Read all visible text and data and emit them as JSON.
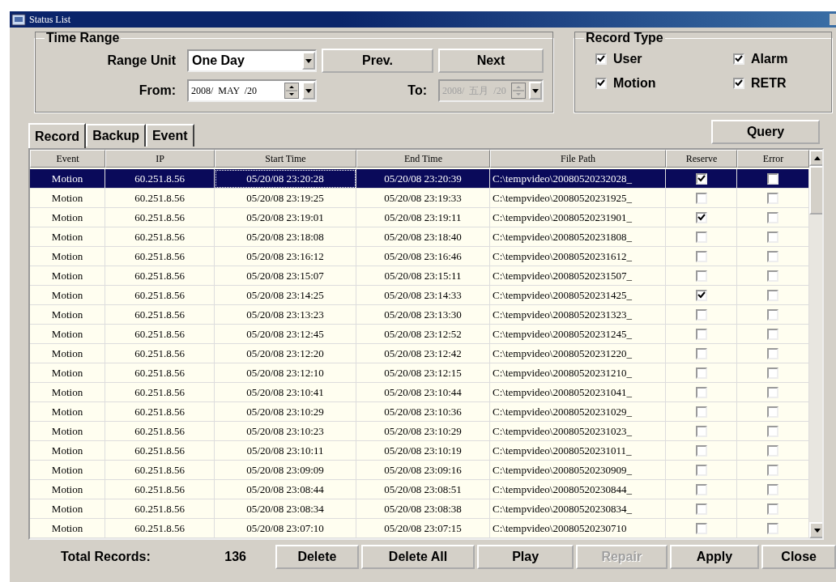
{
  "window": {
    "title": "Status List"
  },
  "time_range": {
    "title": "Time Range",
    "range_unit_label": "Range Unit",
    "range_unit": "One Day",
    "prev": "Prev.",
    "next": "Next",
    "from_label": "From:",
    "from": {
      "value": "2008/  MAY  /20",
      "disabled": false
    },
    "to_label": "To:",
    "to": {
      "value": "2008/  五月  /20",
      "disabled": true
    }
  },
  "record_type": {
    "title": "Record Type",
    "options": [
      {
        "label": "User",
        "checked": true
      },
      {
        "label": "Alarm",
        "checked": true
      },
      {
        "label": "Motion",
        "checked": true
      },
      {
        "label": "RETR",
        "checked": true
      }
    ]
  },
  "tabs": [
    {
      "label": "Record",
      "selected": true
    },
    {
      "label": "Backup",
      "selected": false
    },
    {
      "label": "Event",
      "selected": false
    }
  ],
  "query_button": "Query",
  "table": {
    "columns": [
      "Event",
      "IP",
      "Start Time",
      "End Time",
      "File Path",
      "Reserve",
      "Error"
    ],
    "rows": [
      {
        "event": "Motion",
        "ip": "60.251.8.56",
        "start": "05/20/08 23:20:28",
        "end": "05/20/08 23:20:39",
        "path": "C:\\tempvideo\\20080520232028_",
        "reserve": true,
        "error": false,
        "selected": true
      },
      {
        "event": "Motion",
        "ip": "60.251.8.56",
        "start": "05/20/08 23:19:25",
        "end": "05/20/08 23:19:33",
        "path": "C:\\tempvideo\\20080520231925_",
        "reserve": false,
        "error": false,
        "selected": false
      },
      {
        "event": "Motion",
        "ip": "60.251.8.56",
        "start": "05/20/08 23:19:01",
        "end": "05/20/08 23:19:11",
        "path": "C:\\tempvideo\\20080520231901_",
        "reserve": true,
        "error": false,
        "selected": false
      },
      {
        "event": "Motion",
        "ip": "60.251.8.56",
        "start": "05/20/08 23:18:08",
        "end": "05/20/08 23:18:40",
        "path": "C:\\tempvideo\\20080520231808_",
        "reserve": false,
        "error": false,
        "selected": false
      },
      {
        "event": "Motion",
        "ip": "60.251.8.56",
        "start": "05/20/08 23:16:12",
        "end": "05/20/08 23:16:46",
        "path": "C:\\tempvideo\\20080520231612_",
        "reserve": false,
        "error": false,
        "selected": false
      },
      {
        "event": "Motion",
        "ip": "60.251.8.56",
        "start": "05/20/08 23:15:07",
        "end": "05/20/08 23:15:11",
        "path": "C:\\tempvideo\\20080520231507_",
        "reserve": false,
        "error": false,
        "selected": false
      },
      {
        "event": "Motion",
        "ip": "60.251.8.56",
        "start": "05/20/08 23:14:25",
        "end": "05/20/08 23:14:33",
        "path": "C:\\tempvideo\\20080520231425_",
        "reserve": true,
        "error": false,
        "selected": false
      },
      {
        "event": "Motion",
        "ip": "60.251.8.56",
        "start": "05/20/08 23:13:23",
        "end": "05/20/08 23:13:30",
        "path": "C:\\tempvideo\\20080520231323_",
        "reserve": false,
        "error": false,
        "selected": false
      },
      {
        "event": "Motion",
        "ip": "60.251.8.56",
        "start": "05/20/08 23:12:45",
        "end": "05/20/08 23:12:52",
        "path": "C:\\tempvideo\\20080520231245_",
        "reserve": false,
        "error": false,
        "selected": false
      },
      {
        "event": "Motion",
        "ip": "60.251.8.56",
        "start": "05/20/08 23:12:20",
        "end": "05/20/08 23:12:42",
        "path": "C:\\tempvideo\\20080520231220_",
        "reserve": false,
        "error": false,
        "selected": false
      },
      {
        "event": "Motion",
        "ip": "60.251.8.56",
        "start": "05/20/08 23:12:10",
        "end": "05/20/08 23:12:15",
        "path": "C:\\tempvideo\\20080520231210_",
        "reserve": false,
        "error": false,
        "selected": false
      },
      {
        "event": "Motion",
        "ip": "60.251.8.56",
        "start": "05/20/08 23:10:41",
        "end": "05/20/08 23:10:44",
        "path": "C:\\tempvideo\\20080520231041_",
        "reserve": false,
        "error": false,
        "selected": false
      },
      {
        "event": "Motion",
        "ip": "60.251.8.56",
        "start": "05/20/08 23:10:29",
        "end": "05/20/08 23:10:36",
        "path": "C:\\tempvideo\\20080520231029_",
        "reserve": false,
        "error": false,
        "selected": false
      },
      {
        "event": "Motion",
        "ip": "60.251.8.56",
        "start": "05/20/08 23:10:23",
        "end": "05/20/08 23:10:29",
        "path": "C:\\tempvideo\\20080520231023_",
        "reserve": false,
        "error": false,
        "selected": false
      },
      {
        "event": "Motion",
        "ip": "60.251.8.56",
        "start": "05/20/08 23:10:11",
        "end": "05/20/08 23:10:19",
        "path": "C:\\tempvideo\\20080520231011_",
        "reserve": false,
        "error": false,
        "selected": false
      },
      {
        "event": "Motion",
        "ip": "60.251.8.56",
        "start": "05/20/08 23:09:09",
        "end": "05/20/08 23:09:16",
        "path": "C:\\tempvideo\\20080520230909_",
        "reserve": false,
        "error": false,
        "selected": false
      },
      {
        "event": "Motion",
        "ip": "60.251.8.56",
        "start": "05/20/08 23:08:44",
        "end": "05/20/08 23:08:51",
        "path": "C:\\tempvideo\\20080520230844_",
        "reserve": false,
        "error": false,
        "selected": false
      },
      {
        "event": "Motion",
        "ip": "60.251.8.56",
        "start": "05/20/08 23:08:34",
        "end": "05/20/08 23:08:38",
        "path": "C:\\tempvideo\\20080520230834_",
        "reserve": false,
        "error": false,
        "selected": false
      },
      {
        "event": "Motion",
        "ip": "60.251.8.56",
        "start": "05/20/08 23:07:10",
        "end": "05/20/08 23:07:15",
        "path": "C:\\tempvideo\\20080520230710",
        "reserve": false,
        "error": false,
        "selected": false
      }
    ]
  },
  "footer": {
    "total_label": "Total Records:",
    "total": "136",
    "buttons": [
      {
        "label": "Delete",
        "disabled": false
      },
      {
        "label": "Delete All",
        "disabled": false
      },
      {
        "label": "Play",
        "disabled": false
      },
      {
        "label": "Repair",
        "disabled": true
      },
      {
        "label": "Apply",
        "disabled": false
      },
      {
        "label": "Close",
        "disabled": false
      }
    ]
  }
}
